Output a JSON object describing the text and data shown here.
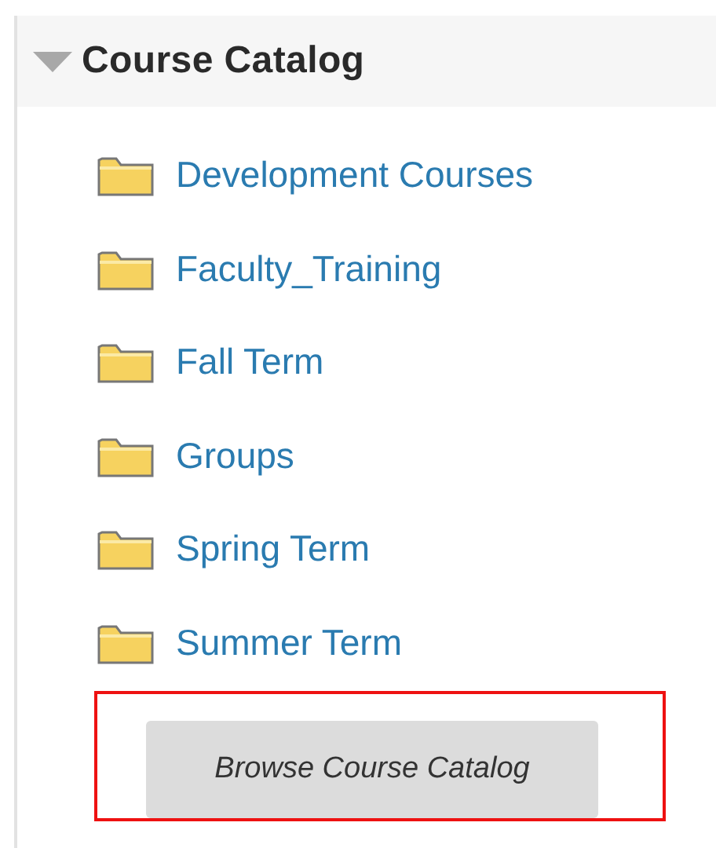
{
  "module": {
    "title": "Course Catalog",
    "expanded": true
  },
  "folders": [
    {
      "label": "Development Courses"
    },
    {
      "label": "Faculty_Training"
    },
    {
      "label": "Fall Term"
    },
    {
      "label": "Groups"
    },
    {
      "label": "Spring Term"
    },
    {
      "label": "Summer Term"
    }
  ],
  "browse_button": {
    "label": "Browse Course Catalog",
    "highlighted": true
  }
}
